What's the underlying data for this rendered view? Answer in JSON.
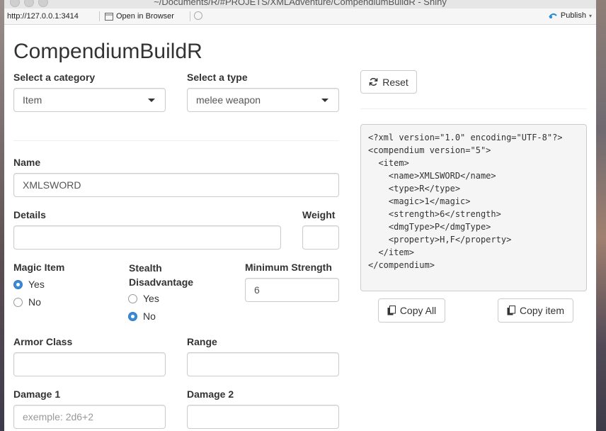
{
  "window": {
    "title": "~/Documents/R/#PROJETS/XMLAdventure/CompendiumBuildR - Shiny"
  },
  "toolbar": {
    "url": "http://127.0.0.1:3414",
    "open_in_browser": "Open in Browser",
    "publish": "Publish"
  },
  "app": {
    "title": "CompendiumBuildR"
  },
  "category": {
    "label": "Select a category",
    "value": "Item"
  },
  "type": {
    "label": "Select a type",
    "value": "melee weapon"
  },
  "reset_label": "Reset",
  "name": {
    "label": "Name",
    "value": "XMLSWORD"
  },
  "details": {
    "label": "Details",
    "value": ""
  },
  "weight": {
    "label": "Weight",
    "value": ""
  },
  "magic_item": {
    "label": "Magic Item",
    "options": [
      "Yes",
      "No"
    ],
    "selected": "Yes"
  },
  "stealth": {
    "label": "Stealth Disadvantage",
    "options": [
      "Yes",
      "No"
    ],
    "selected": "No"
  },
  "min_strength": {
    "label": "Minimum Strength",
    "value": "6"
  },
  "armor_class": {
    "label": "Armor Class",
    "value": ""
  },
  "range": {
    "label": "Range",
    "value": ""
  },
  "damage1": {
    "label": "Damage 1",
    "placeholder": "exemple: 2d6+2"
  },
  "damage2": {
    "label": "Damage 2",
    "value": ""
  },
  "xml_lines": [
    "<?xml version=\"1.0\" encoding=\"UTF-8\"?>",
    "<compendium version=\"5\">",
    "  <item>",
    "    <name>XMLSWORD</name>",
    "    <type>R</type>",
    "    <magic>1</magic>",
    "    <strength>6</strength>",
    "    <dmgType>P</dmgType>",
    "    <property>H,F</property>",
    "  </item>",
    "</compendium>"
  ],
  "copy_all_label": "Copy All",
  "copy_item_label": "Copy item",
  "colors": {
    "radio_checked": "#3b8ad8",
    "xml_bg": "#f5f5f5",
    "border": "#cccccc"
  },
  "icons": {
    "reset": "refresh-icon",
    "copy": "copy-icon",
    "dropdown": "caret-down-icon",
    "publish": "publish-icon"
  }
}
